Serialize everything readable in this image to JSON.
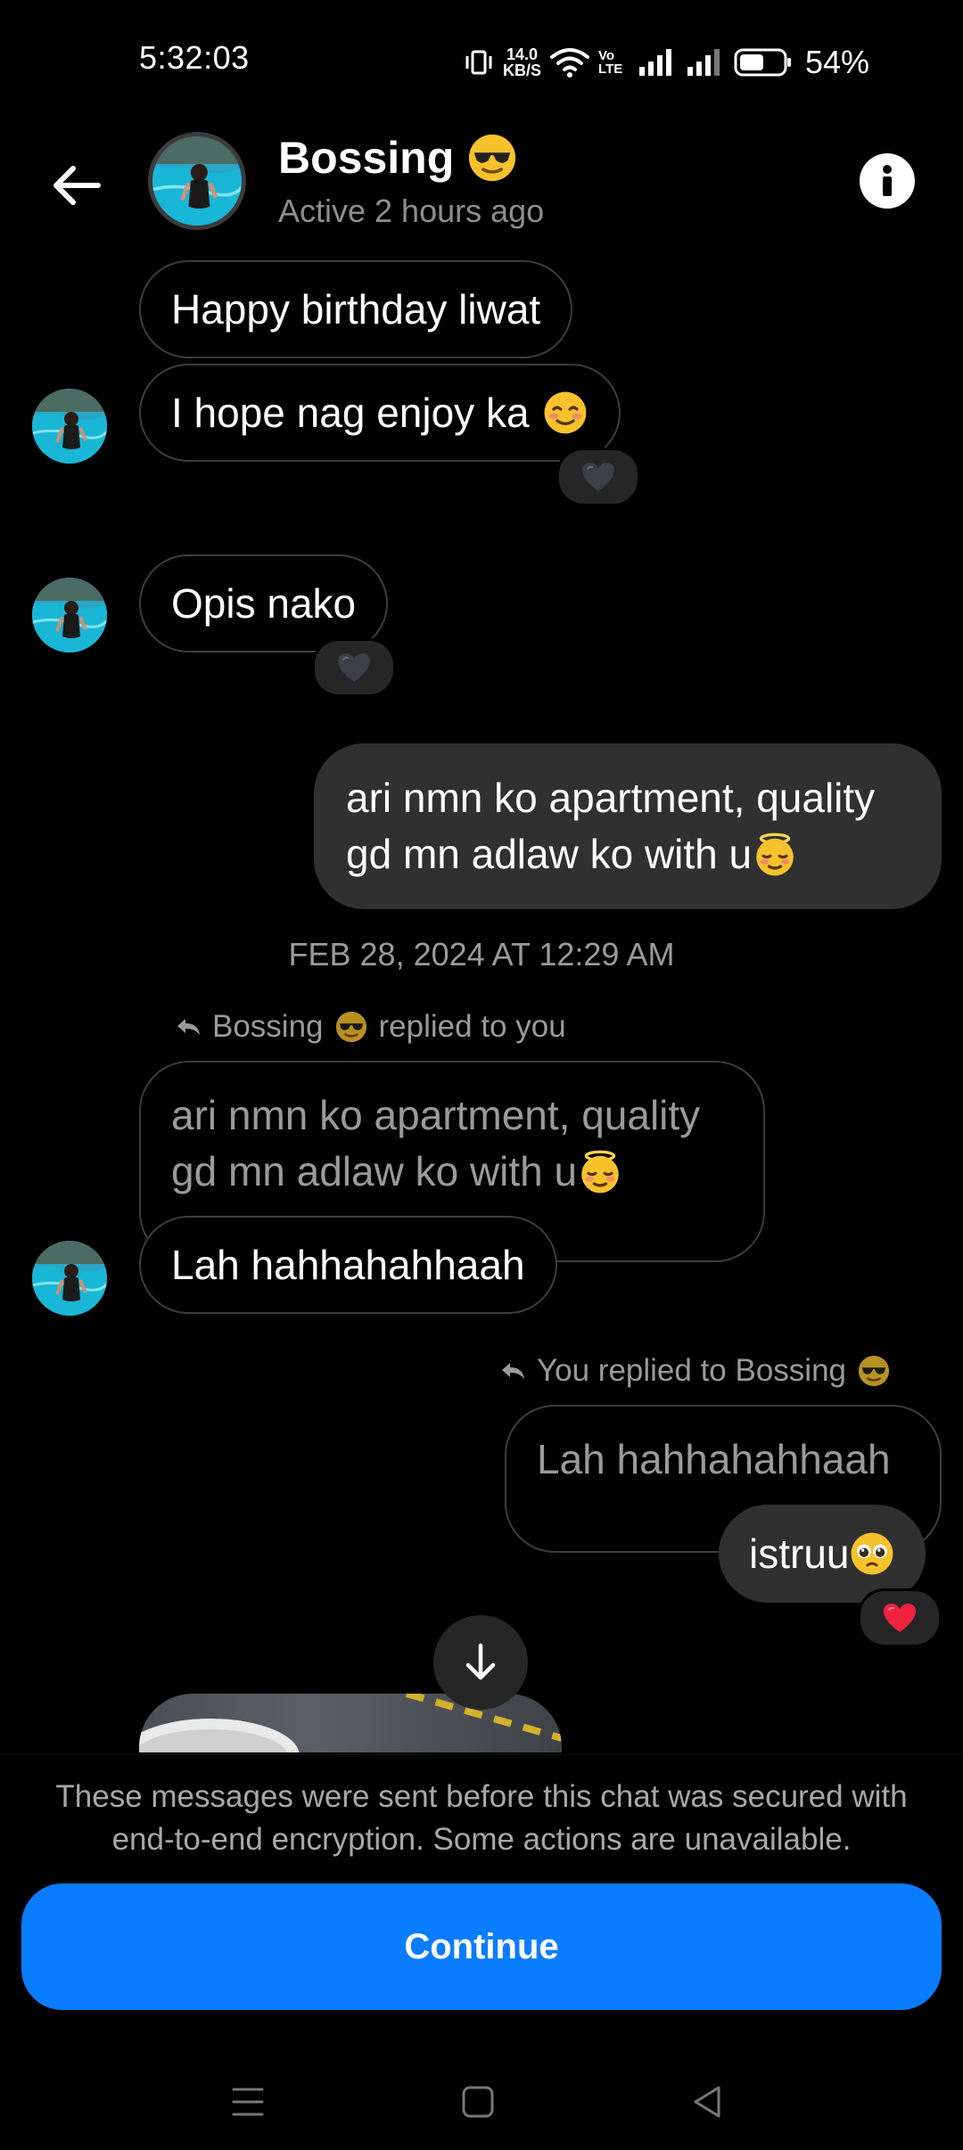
{
  "status_bar": {
    "time": "5:32:03",
    "net_speed_value": "14.0",
    "net_speed_unit": "KB/S",
    "volte_label": "Vo LTE",
    "battery_percent": "54%"
  },
  "header": {
    "contact_name": "Bossing",
    "active_status": "Active 2 hours ago"
  },
  "messages": {
    "m1": "Happy birthday liwat",
    "m2": "I hope nag enjoy ka",
    "m3": "Opis nako",
    "m4_line1": "ari nmn ko apartment, quality",
    "m4_line2": "gd mn adlaw ko with u",
    "timestamp": "FEB 28, 2024 AT 12:29 AM",
    "reply1_meta_a": "Bossing",
    "reply1_meta_b": "replied to you",
    "reply1_quote_line1": "ari nmn ko apartment, quality",
    "reply1_quote_line2": "gd mn adlaw ko with u",
    "m5": "Lah hahhahahhaah",
    "reply2_meta_a": "You replied to Bossing",
    "reply2_quote": "Lah hahhahahhaah",
    "m6": "istruu"
  },
  "reactions": {
    "black_heart": "black-heart",
    "red_heart": "red-heart"
  },
  "footer": {
    "notice": "These messages were sent before this chat was secured with end-to-end encryption. Some actions are unavailable.",
    "continue_label": "Continue"
  },
  "colors": {
    "accent": "#0a7cff",
    "outgoing_bubble": "#303030",
    "incoming_border": "#3d3d3d",
    "muted_text": "#8e8e8e"
  }
}
